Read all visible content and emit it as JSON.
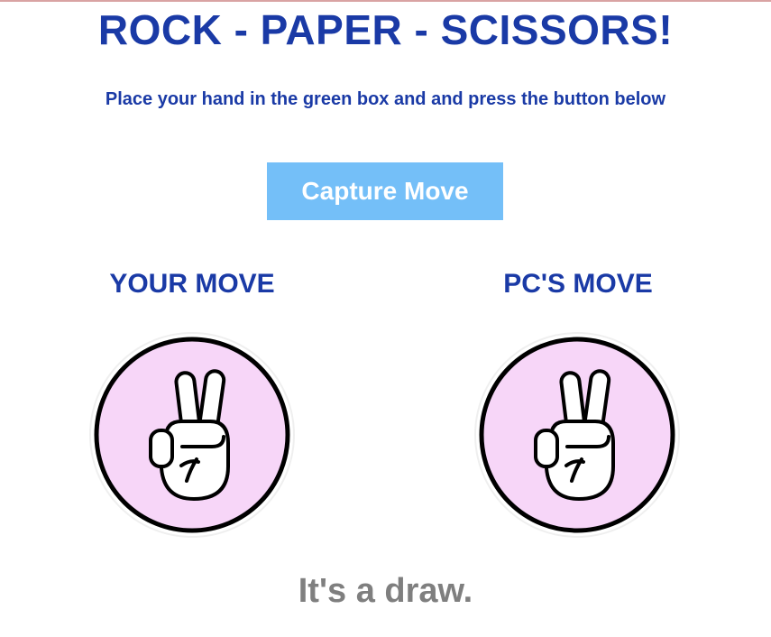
{
  "title": "ROCK - PAPER - SCISSORS!",
  "instructions": "Place your hand in the green box and and press the button below",
  "capture_button_label": "Capture Move",
  "moves": {
    "user": {
      "heading": "YOUR MOVE",
      "icon": "peace-hand-icon"
    },
    "pc": {
      "heading": "PC'S MOVE",
      "icon": "peace-hand-icon"
    }
  },
  "result": "It's a draw.",
  "colors": {
    "heading_blue": "#1a3aa6",
    "button_bg": "#74bff8",
    "badge_fill": "#f7d6f8",
    "result_gray": "#7f7f7f"
  }
}
